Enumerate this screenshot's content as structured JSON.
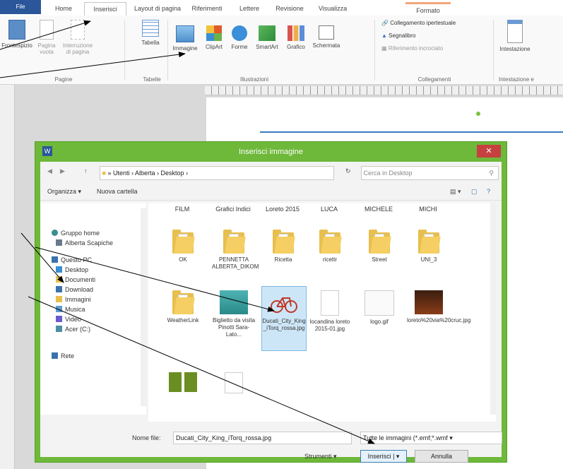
{
  "ribbon": {
    "tabs": [
      "File",
      "Home",
      "Inserisci",
      "Layout di pagina",
      "Riferimenti",
      "Lettere",
      "Revisione",
      "Visualizza",
      "Formato"
    ],
    "pagine_items": [
      "Frontespizio",
      "Pagina vuota",
      "Interruzione di pagina"
    ],
    "tabella_label": "Tabella",
    "illustrazioni_items": [
      "Immagine",
      "ClipArt",
      "Forme",
      "SmartArt",
      "Grafico",
      "Schermata"
    ],
    "collegamenti_items": [
      "Collegamento ipertestuale",
      "Segnalibro",
      "Riferimento incrociato"
    ],
    "intestazione_label": "Intestazione",
    "group_labels": {
      "pagine": "Pagine",
      "tabelle": "Tabelle",
      "illustrazioni": "Illustrazioni",
      "collegamenti": "Collegamenti",
      "intestazione": "Intestazione e"
    }
  },
  "dialog": {
    "title": "Inserisci immagine",
    "breadcrumb": [
      "Utenti",
      "Alberta",
      "Desktop"
    ],
    "search_placeholder": "Cerca in Desktop",
    "organize_label": "Organizza ▾",
    "new_folder_label": "Nuova cartella",
    "nav_items": [
      "Gruppo home",
      "Alberta Scapiche",
      "Questo PC",
      "Desktop",
      "Documenti",
      "Download",
      "Immagini",
      "Musica",
      "Video",
      "Acer (C:)",
      "Rete"
    ],
    "column_headers": [
      "FILM",
      "Grafici Indici",
      "Loreto 2015",
      "LUCA",
      "MICHELE",
      "MICHI"
    ],
    "row1": [
      "OK",
      "PENNETTA ALBERTA_DIKOM",
      "Ricetta",
      "ricettr",
      "Street",
      "UNI_3"
    ],
    "row2": [
      "WeatherLink",
      "Biglietto da visita Pinotti Sara-Lato...",
      "Ducati_City_King_iTorq_rossa.jpg",
      "locandina loreto 2015-01.jpg",
      "logo.gif",
      "loreto%20via%20cruc.jpg"
    ],
    "filename_label": "Nome file:",
    "filename_value": "Ducati_City_King_iTorq_rossa.jpg",
    "filetype_value": "Tutte le immagini (*.emf;*.wmf",
    "tools_label": "Strumenti",
    "insert_label": "Inserisci",
    "cancel_label": "Annulla"
  },
  "colors": {
    "file_tab": "#2b579a",
    "dialog_frame": "#6eb83a",
    "close": "#c74040",
    "folder": "#e8bf4e",
    "selection": "#cde6f7"
  }
}
